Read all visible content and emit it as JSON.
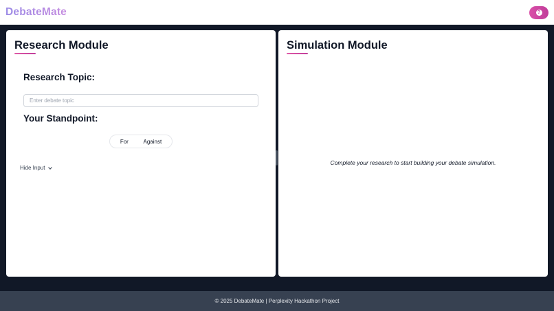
{
  "header": {
    "brand": "DebateMate",
    "help_icon": "question-icon"
  },
  "research": {
    "title": "Research Module",
    "topic_label": "Research Topic:",
    "topic_placeholder": "Enter debate topic",
    "topic_value": "",
    "standpoint_label": "Your Standpoint:",
    "stance_options": [
      "For",
      "Against"
    ],
    "hide_input_label": "Hide Input",
    "hide_input_icon": "chevron-down-icon"
  },
  "simulation": {
    "title": "Simulation Module",
    "empty_message": "Complete your research to start building your debate simulation."
  },
  "footer": {
    "text": "© 2025 DebateMate | Perplexity Hackathon Project"
  },
  "colors": {
    "accent_pink": "#d94fa8",
    "brand_gradient_start": "#9b8ae6",
    "brand_gradient_end": "#c58be0",
    "background_dark": "#111827",
    "footer_bg": "#374151"
  }
}
